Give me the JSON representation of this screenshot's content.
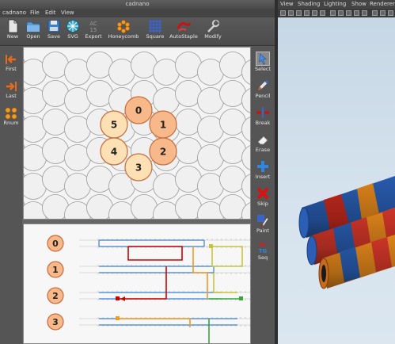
{
  "window": {
    "title": "cadnano"
  },
  "menubar": {
    "items": [
      "cadnano",
      "File",
      "Edit",
      "View"
    ]
  },
  "toolbar": {
    "buttons": [
      {
        "label": "New",
        "icon": "new-document-icon"
      },
      {
        "label": "Open",
        "icon": "folder-icon"
      },
      {
        "label": "Save",
        "icon": "save-icon"
      },
      {
        "label": "SVG",
        "icon": "svg-icon"
      },
      {
        "label": "Export",
        "icon": "export-icon"
      },
      {
        "label": "Honeycomb",
        "icon": "honeycomb-icon"
      },
      {
        "label": "Square",
        "icon": "square-lattice-icon"
      },
      {
        "label": "AutoStaple",
        "icon": "autostaple-icon"
      },
      {
        "label": "Modify",
        "icon": "modify-icon"
      }
    ]
  },
  "leftbar": {
    "buttons": [
      {
        "label": "First",
        "icon": "first-arrow-icon"
      },
      {
        "label": "Last",
        "icon": "last-arrow-icon"
      },
      {
        "label": "Rnum",
        "icon": "renumber-icon"
      }
    ]
  },
  "rightbar": {
    "buttons": [
      {
        "label": "Select",
        "icon": "select-arrow-icon"
      },
      {
        "label": "Pencil",
        "icon": "pencil-icon"
      },
      {
        "label": "Break",
        "icon": "break-icon"
      },
      {
        "label": "Erase",
        "icon": "eraser-icon"
      },
      {
        "label": "Insert",
        "icon": "insert-plus-icon"
      },
      {
        "label": "Skip",
        "icon": "skip-x-icon"
      },
      {
        "label": "Paint",
        "icon": "paint-icon"
      },
      {
        "label": "Seq",
        "icon": "sequence-icon"
      }
    ]
  },
  "slice_helices": [
    "0",
    "1",
    "2",
    "3",
    "4",
    "5"
  ],
  "path_helices": [
    "0",
    "1",
    "2",
    "3"
  ],
  "maya": {
    "menu": [
      "View",
      "Shading",
      "Lighting",
      "Show",
      "Renderer"
    ]
  },
  "colors": {
    "helix_fill": "#f7b98a",
    "helix_fill_light": "#fde0b3",
    "helix_stroke": "#c86a3a",
    "empty_cell": "#f0f0f0",
    "strand_red": "#cc0000",
    "strand_blue": "#3b7fd1",
    "strand_orange": "#f29a22",
    "strand_green": "#3aa33a",
    "strand_yellow": "#c8c33a"
  }
}
